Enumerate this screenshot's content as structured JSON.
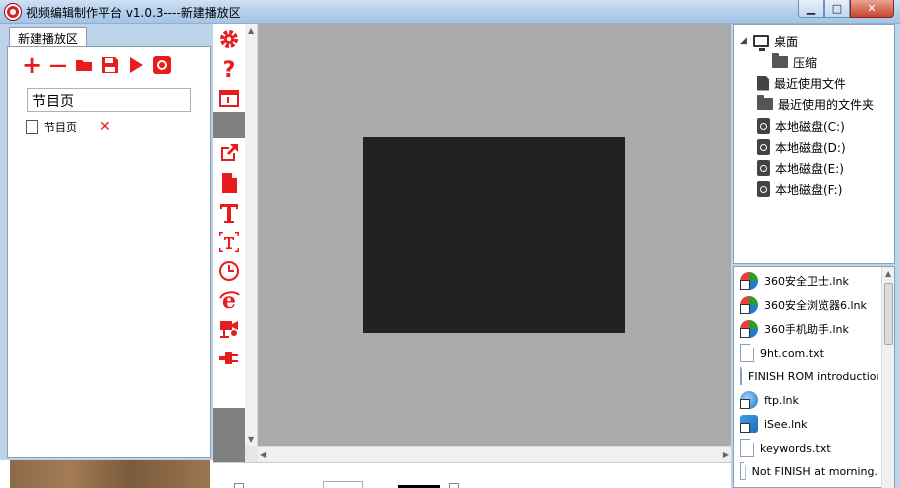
{
  "window": {
    "title": "视频编辑制作平台 v1.0.3----新建播放区",
    "minimize": "▁",
    "maximize": "□",
    "close": "✕"
  },
  "left_panel": {
    "tab_label": "新建播放区",
    "toolbar": {
      "add": "+",
      "remove": "—"
    },
    "page_name_value": "节目页",
    "pages": [
      {
        "label": "节目页",
        "delete": "✕"
      }
    ]
  },
  "canvas": {
    "scroll_up": "▲",
    "scroll_down": "▼",
    "scroll_left": "◀",
    "scroll_right": "▶"
  },
  "folder_tree": {
    "expand": "◢",
    "items": [
      {
        "label": "桌面",
        "icon": "monitor-icon"
      },
      {
        "label": "压缩",
        "icon": "folder-icon"
      },
      {
        "label": "最近使用文件",
        "icon": "file-icon"
      },
      {
        "label": "最近使用的文件夹",
        "icon": "folder-icon"
      },
      {
        "label": "本地磁盘(C:)",
        "icon": "disk-icon"
      },
      {
        "label": "本地磁盘(D:)",
        "icon": "disk-icon"
      },
      {
        "label": "本地磁盘(E:)",
        "icon": "disk-icon"
      },
      {
        "label": "本地磁盘(F:)",
        "icon": "disk-icon"
      }
    ]
  },
  "file_list": {
    "scroll_up": "▲",
    "items": [
      {
        "label": "360安全卫士.lnk",
        "icon": "360-icon"
      },
      {
        "label": "360安全浏览器6.lnk",
        "icon": "360-icon"
      },
      {
        "label": "360手机助手.lnk",
        "icon": "360-icon"
      },
      {
        "label": "9ht.com.txt",
        "icon": "txt-icon"
      },
      {
        "label": "FINISH ROM introduction",
        "icon": "txt-icon"
      },
      {
        "label": "ftp.lnk",
        "icon": "ftp-icon"
      },
      {
        "label": "iSee.lnk",
        "icon": "isee-icon"
      },
      {
        "label": "keywords.txt",
        "icon": "txt-icon"
      },
      {
        "label": "Not FINISH at morning.",
        "icon": "txt-icon"
      }
    ]
  },
  "colors": {
    "accent_red": "#e81c1c",
    "stage_gray": "#aaaaaa",
    "stage_black": "#222222"
  }
}
